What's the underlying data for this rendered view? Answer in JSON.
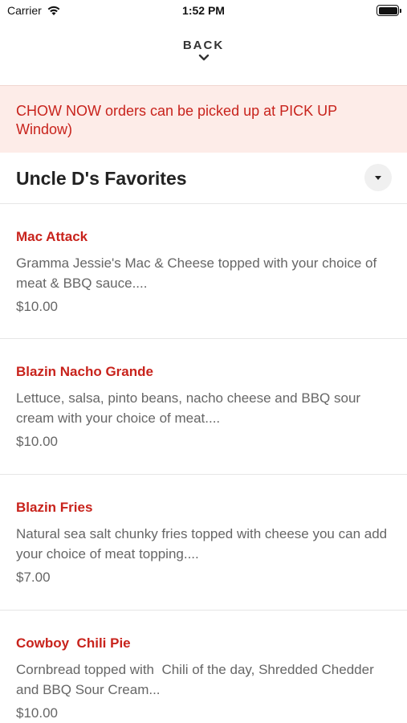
{
  "status_bar": {
    "carrier": "Carrier",
    "time": "1:52 PM"
  },
  "nav": {
    "back_label": "BACK"
  },
  "banner": {
    "text": "CHOW NOW orders can be picked up at PICK UP Window)"
  },
  "section": {
    "title": "Uncle D's Favorites"
  },
  "menu_items": [
    {
      "name": "Mac Attack",
      "description": "Gramma Jessie's Mac & Cheese topped with your choice of meat & BBQ sauce....",
      "price": "$10.00"
    },
    {
      "name": "Blazin Nacho Grande",
      "description": "Lettuce, salsa, pinto beans, nacho cheese and BBQ sour cream with your choice of meat....",
      "price": "$10.00"
    },
    {
      "name": "Blazin Fries",
      "description": "Natural sea salt chunky fries topped with cheese you can add your choice of meat topping....",
      "price": "$7.00"
    },
    {
      "name": "Cowboy  Chili Pie",
      "description": "Cornbread topped with  Chili of the day, Shredded Chedder and BBQ Sour Cream...",
      "price": "$10.00"
    }
  ],
  "colors": {
    "accent": "#c8231c",
    "banner_bg": "#fdece8",
    "muted_text": "#666666"
  }
}
